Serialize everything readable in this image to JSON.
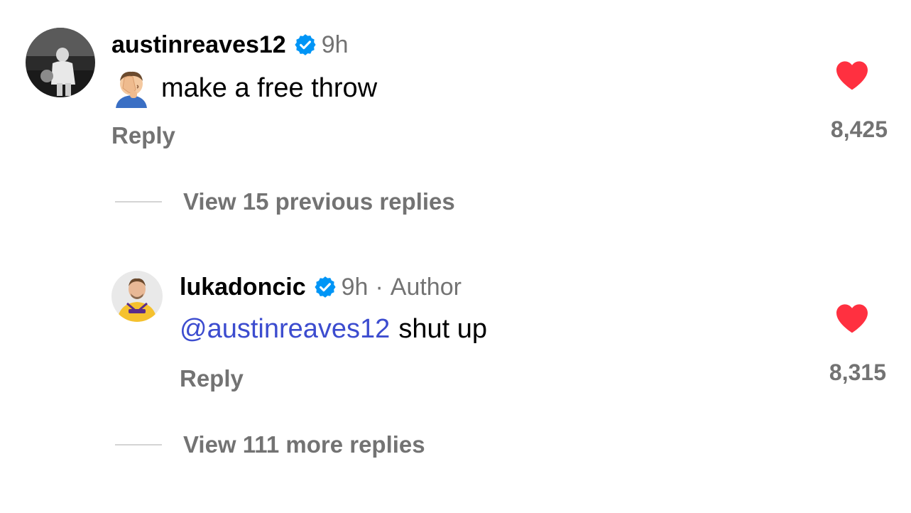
{
  "comments": [
    {
      "username": "austinreaves12",
      "time": "9h",
      "verified": true,
      "text": "make a free throw",
      "emoji": "facepalm-emoji",
      "reply_label": "Reply",
      "likes": "8,425",
      "liked": true
    },
    {
      "username": "lukadoncic",
      "time": "9h",
      "separator": "·",
      "author_tag": "Author",
      "verified": true,
      "mention": "@austinreaves12",
      "text": "shut up",
      "reply_label": "Reply",
      "likes": "8,315",
      "liked": true
    }
  ],
  "view_previous": "View 15 previous replies",
  "view_more": "View 111 more replies",
  "colors": {
    "heart": "#ff3040",
    "verified": "#0095f6",
    "mention": "#3c4ccf",
    "secondary_text": "#737373"
  }
}
